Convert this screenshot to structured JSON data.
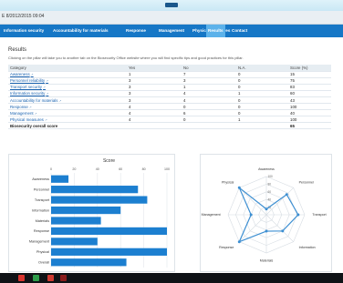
{
  "header": {
    "title": "E 8/2012/2015 09:04"
  },
  "nav": [
    {
      "label": "Information security",
      "active": false
    },
    {
      "label": "Accountability for materials",
      "active": false
    },
    {
      "label": "Response",
      "active": false
    },
    {
      "label": "Management",
      "active": false
    },
    {
      "label": "Physical measures",
      "active": false
    },
    {
      "label": "Results",
      "active": true
    },
    {
      "label": "Contact",
      "active": false
    }
  ],
  "results": {
    "title": "Results",
    "description": "Clicking on the pillar will take you to another tab on the Biosecurity Office website where you will find specific tips and good practices for this pillar.",
    "columns": [
      "Category",
      "Yes",
      "No",
      "N.A.",
      "Score (%)"
    ],
    "rows": [
      {
        "category": "Awareness",
        "yes": "1",
        "no": "7",
        "na": "0",
        "score": "15"
      },
      {
        "category": "Personnel reliability",
        "yes": "3",
        "no": "3",
        "na": "0",
        "score": "75"
      },
      {
        "category": "Transport security",
        "yes": "3",
        "no": "1",
        "na": "0",
        "score": "83"
      },
      {
        "category": "Information security",
        "yes": "3",
        "no": "4",
        "na": "1",
        "score": "60"
      },
      {
        "category": "Accountability for materials",
        "yes": "3",
        "no": "4",
        "na": "0",
        "score": "43"
      },
      {
        "category": "Response",
        "yes": "4",
        "no": "0",
        "na": "0",
        "score": "100"
      },
      {
        "category": "Management",
        "yes": "4",
        "no": "6",
        "na": "0",
        "score": "40"
      },
      {
        "category": "Physical measures",
        "yes": "4",
        "no": "0",
        "na": "1",
        "score": "100"
      }
    ],
    "total": {
      "category": "Biosecurity overall score",
      "score": "65"
    }
  },
  "colors": {
    "nav": "#1677c6",
    "nav_active": "#5cb2ea",
    "bar": "#1c7fd0",
    "radar": "#3d8fd2"
  },
  "taskbar_icons": [
    "explorer-icon",
    "store-icon",
    "mail-icon",
    "close-app-icon"
  ],
  "chart_data": [
    {
      "type": "bar",
      "orientation": "horizontal",
      "title": "Score",
      "categories": [
        "Awareness",
        "Personnel",
        "Transport",
        "Information",
        "Materials",
        "Response",
        "Management",
        "Physical",
        "Overall"
      ],
      "values": [
        15,
        75,
        83,
        60,
        43,
        100,
        40,
        100,
        65
      ],
      "xlim": [
        0,
        100
      ],
      "ticks": [
        0,
        20,
        40,
        60,
        80,
        100
      ],
      "grid": true
    },
    {
      "type": "radar",
      "axes": [
        "Awareness",
        "Personnel",
        "Transport",
        "Information",
        "Materials",
        "Response",
        "Management",
        "Physical"
      ],
      "values": [
        15,
        75,
        83,
        60,
        43,
        100,
        40,
        100
      ],
      "rlim": [
        0,
        100
      ],
      "ticks": [
        20,
        40,
        60,
        80,
        100
      ],
      "grid": true
    }
  ]
}
